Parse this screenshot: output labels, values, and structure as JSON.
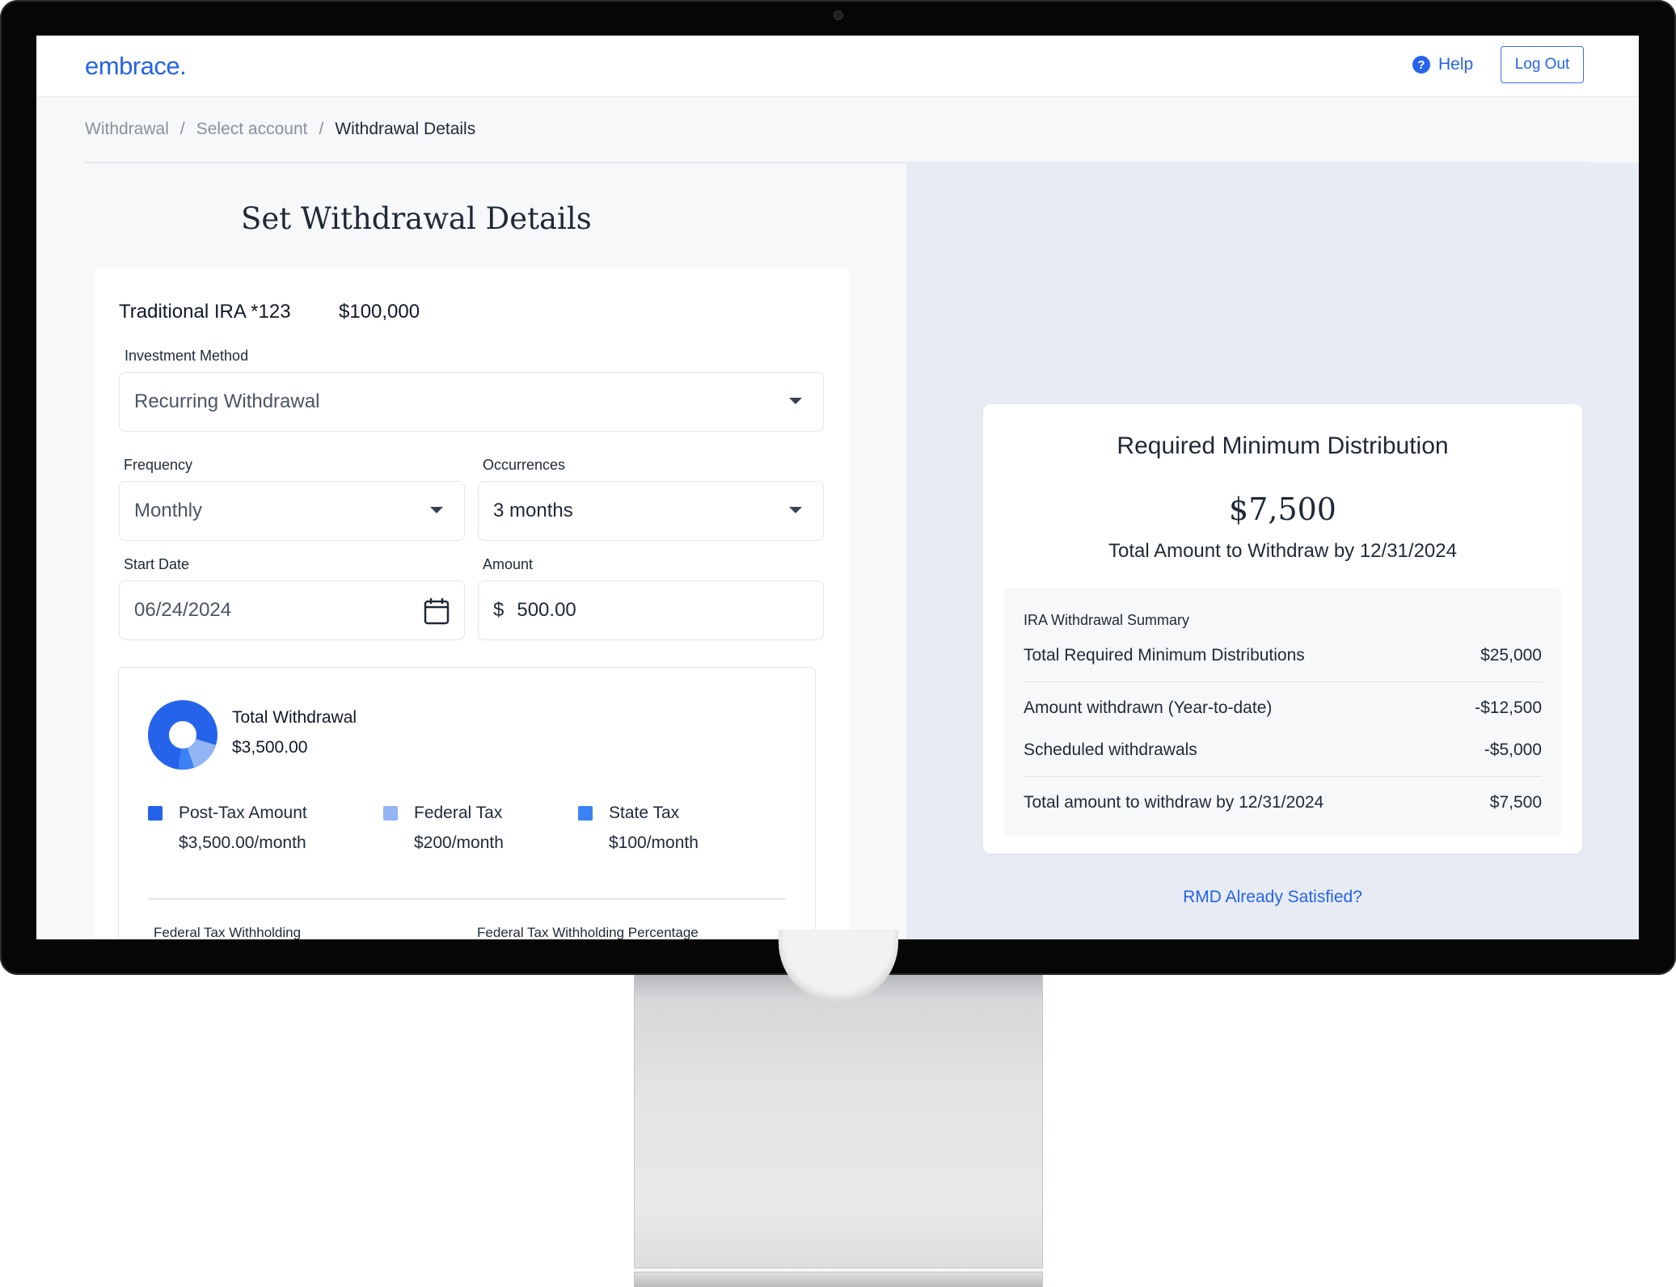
{
  "brand": {
    "logo": "embrace.",
    "accent": "#2563eb"
  },
  "header": {
    "help_label": "Help",
    "logout_label": "Log Out"
  },
  "breadcrumb": {
    "items": [
      "Withdrawal",
      "Select account",
      "Withdrawal Details"
    ],
    "separator": "/"
  },
  "form": {
    "title": "Set Withdrawal Details",
    "account_name": "Traditional IRA *123",
    "account_balance": "$100,000",
    "investment_method": {
      "label": "Investment Method",
      "value": "Recurring Withdrawal"
    },
    "frequency": {
      "label": "Frequency",
      "value": "Monthly"
    },
    "occurrences": {
      "label": "Occurrences",
      "value": "3 months"
    },
    "start_date": {
      "label": "Start Date",
      "value": "06/24/2024"
    },
    "amount": {
      "label": "Amount",
      "currency": "$",
      "value": "500.00"
    }
  },
  "breakdown": {
    "total_label": "Total Withdrawal",
    "total_value": "$3,500.00",
    "legend": [
      {
        "name": "Post-Tax Amount",
        "value": "$3,500.00/month",
        "color": "#2563eb"
      },
      {
        "name": "Federal Tax",
        "value": "$200/month",
        "color": "#93b4f5"
      },
      {
        "name": "State Tax",
        "value": "$100/month",
        "color": "#3b82f6"
      }
    ],
    "withholding_label": "Federal Tax Withholding",
    "withholding_pct_label": "Federal Tax Withholding Percentage"
  },
  "rmd": {
    "title": "Required Minimum Distribution",
    "amount": "$7,500",
    "subtitle": "Total Amount to Withdraw by 12/31/2024",
    "summary_heading": "IRA Withdrawal Summary",
    "rows": [
      {
        "label": "Total Required Minimum Distributions",
        "value": "$25,000"
      },
      {
        "label": "Amount withdrawn (Year-to-date)",
        "value": "-$12,500"
      },
      {
        "label": "Scheduled withdrawals",
        "value": "-$5,000"
      },
      {
        "label": "Total amount to withdraw by 12/31/2024",
        "value": "$7,500"
      }
    ],
    "link": "RMD Already Satisfied?"
  }
}
